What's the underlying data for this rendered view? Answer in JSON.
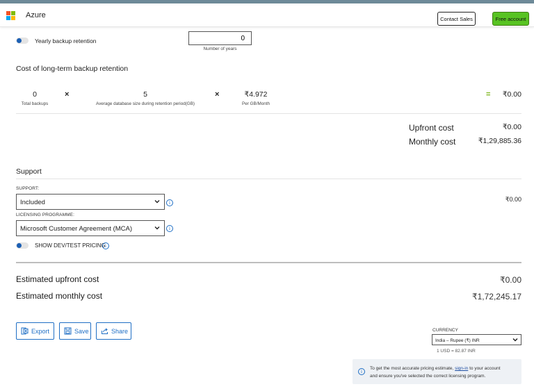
{
  "header": {
    "brand": "Azure",
    "contact_sales": "Contact Sales",
    "free_account": "Free account",
    "logo_colors": [
      "#f35325",
      "#81bc06",
      "#05a6f0",
      "#ffba08"
    ]
  },
  "backup": {
    "yearly_label": "Yearly backup retention",
    "years_value": "0",
    "years_caption": "Number of years",
    "section_title": "Cost of long-term backup retention",
    "total_backups": "0",
    "total_backups_label": "Total backups",
    "multiply": "×",
    "avg_size": "5",
    "avg_size_label": "Average database size during retention period(GB)",
    "per_gb": "₹4.972",
    "per_gb_label": "Per GB/Month",
    "equals": "=",
    "result": "₹0.00"
  },
  "costs": {
    "upfront_label": "Upfront cost",
    "upfront_value": "₹0.00",
    "monthly_label": "Monthly cost",
    "monthly_value": "₹1,29,885.36"
  },
  "support": {
    "title": "Support",
    "support_caption": "SUPPORT:",
    "support_value": "Included",
    "licensing_caption": "LICENSING PROGRAMME:",
    "licensing_value": "Microsoft Customer Agreement (MCA)",
    "devtest_label": "SHOW DEV/TEST PRICING",
    "cost": "₹0.00"
  },
  "estimate": {
    "upfront_label": "Estimated upfront cost",
    "upfront_value": "₹0.00",
    "monthly_label": "Estimated monthly cost",
    "monthly_value": "₹1,72,245.17"
  },
  "actions": {
    "export": "Export",
    "save": "Save",
    "share": "Share"
  },
  "currency": {
    "caption": "CURRENCY",
    "value": "India – Rupee (₹) INR",
    "rate": "1 USD = 82.87 INR"
  },
  "notice": {
    "line1_pre": "To get the most accurate pricing estimate,",
    "signin": "sign-in",
    "line1_post": "to your account",
    "line2": "and ensure you've selected the correct licensing program."
  },
  "accent": "#1f6fc5"
}
